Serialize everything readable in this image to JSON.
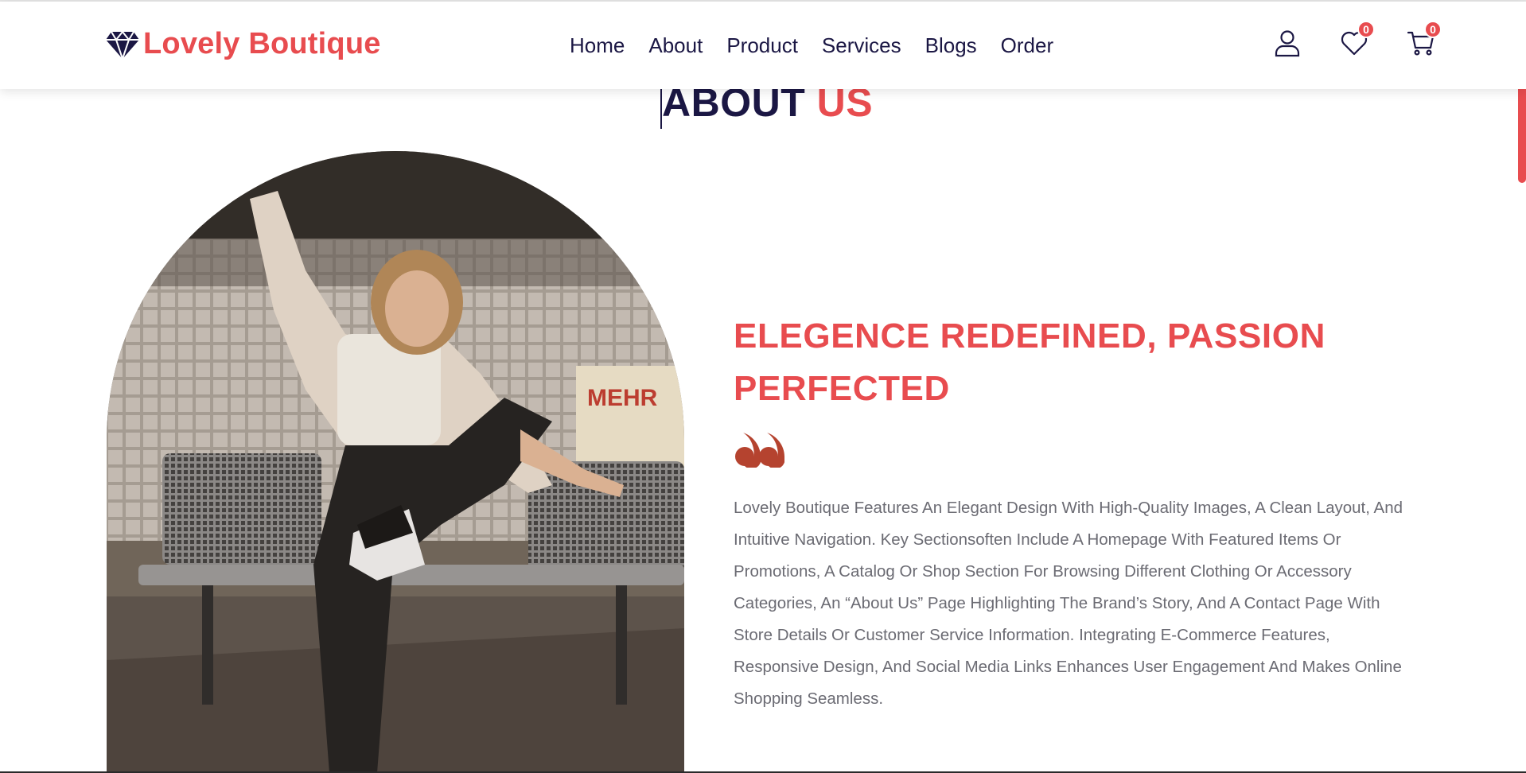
{
  "brand": {
    "name": "Lovely Boutique",
    "logo_icon": "diamond-icon"
  },
  "nav": {
    "links": [
      "Home",
      "About",
      "Product",
      "Services",
      "Blogs",
      "Order"
    ]
  },
  "header_icons": {
    "user_icon": "user-icon",
    "wishlist_icon": "heart-icon",
    "wishlist_count": "0",
    "cart_icon": "cart-icon",
    "cart_count": "0"
  },
  "about": {
    "heading_part1": "ABOUT",
    "heading_part2": "US",
    "image_alt": "Woman in a fluffy jacket sitting on a metal bench at a train station",
    "tagline": "ELEGENCE REDEFINED, PASSION PERFECTED",
    "quote_icon": "quote-icon",
    "description": "Lovely Boutique Features An Elegant Design With High-Quality Images, A Clean Layout, And Intuitive Navigation. Key Sectionsoften Include A Homepage With Featured Items Or Promotions, A Catalog Or Shop Section For Browsing Different Clothing Or Accessory Categories, An “About Us” Page Highlighting The Brand’s Story, And A Contact Page With Store Details Or Customer Service Information. Integrating E-Commerce Features, Responsive Design, And Social Media Links Enhances User Engagement And Makes Online Shopping Seamless."
  },
  "colors": {
    "accent": "#e84c4f",
    "navy": "#1b1744",
    "body_text": "#6b6b73",
    "quote": "#b5432f"
  }
}
